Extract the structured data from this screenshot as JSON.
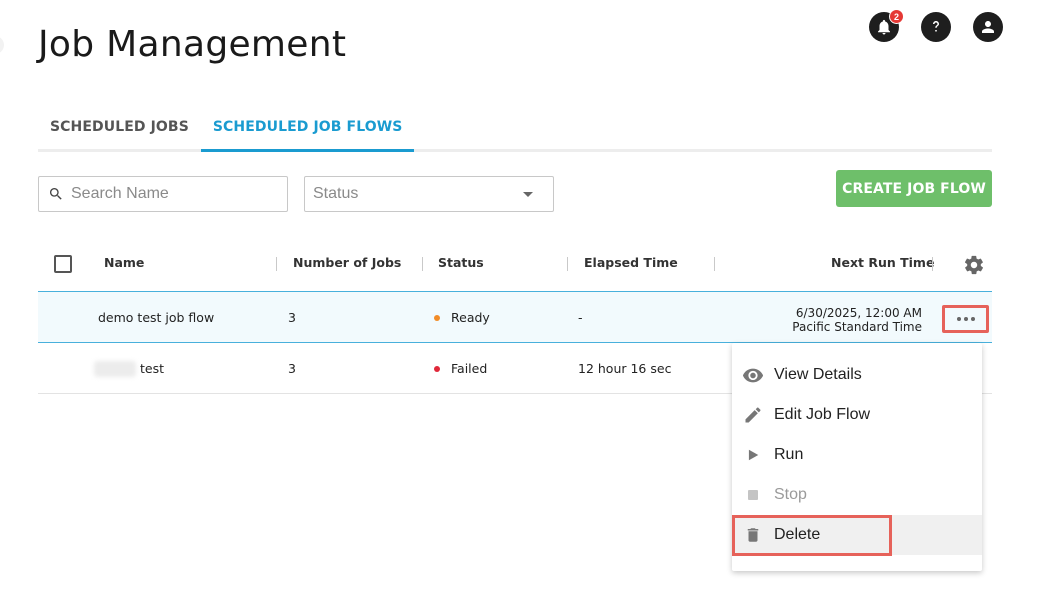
{
  "page": {
    "title": "Job Management"
  },
  "header": {
    "notification_count": "2"
  },
  "tabs": [
    {
      "label": "SCHEDULED JOBS",
      "active": false
    },
    {
      "label": "SCHEDULED JOB FLOWS",
      "active": true
    }
  ],
  "filters": {
    "search_placeholder": "Search Name",
    "status_placeholder": "Status"
  },
  "actions": {
    "create_label": "CREATE JOB FLOW"
  },
  "table": {
    "columns": [
      "Name",
      "Number of Jobs",
      "Status",
      "Elapsed Time",
      "Next Run Time"
    ],
    "rows": [
      {
        "name": "demo test job flow",
        "jobs": "3",
        "status": "Ready",
        "status_color": "#f28c28",
        "elapsed": "-",
        "next_run_line1": "6/30/2025, 12:00 AM",
        "next_run_line2": "Pacific Standard Time"
      },
      {
        "name": "test",
        "jobs": "3",
        "status": "Failed",
        "status_color": "#e0283a",
        "elapsed": "12 hour 16 sec",
        "next_run_line1": "",
        "next_run_line2": ""
      }
    ]
  },
  "context_menu": {
    "items": [
      {
        "label": "View Details",
        "icon": "eye-icon"
      },
      {
        "label": "Edit Job Flow",
        "icon": "pencil-icon"
      },
      {
        "label": "Run",
        "icon": "play-icon"
      },
      {
        "label": "Stop",
        "icon": "stop-icon",
        "disabled": true
      },
      {
        "label": "Delete",
        "icon": "trash-icon"
      }
    ]
  },
  "colors": {
    "accent": "#1a9bd0",
    "create_button": "#6ebf6a",
    "highlight_box": "#e6625a"
  }
}
